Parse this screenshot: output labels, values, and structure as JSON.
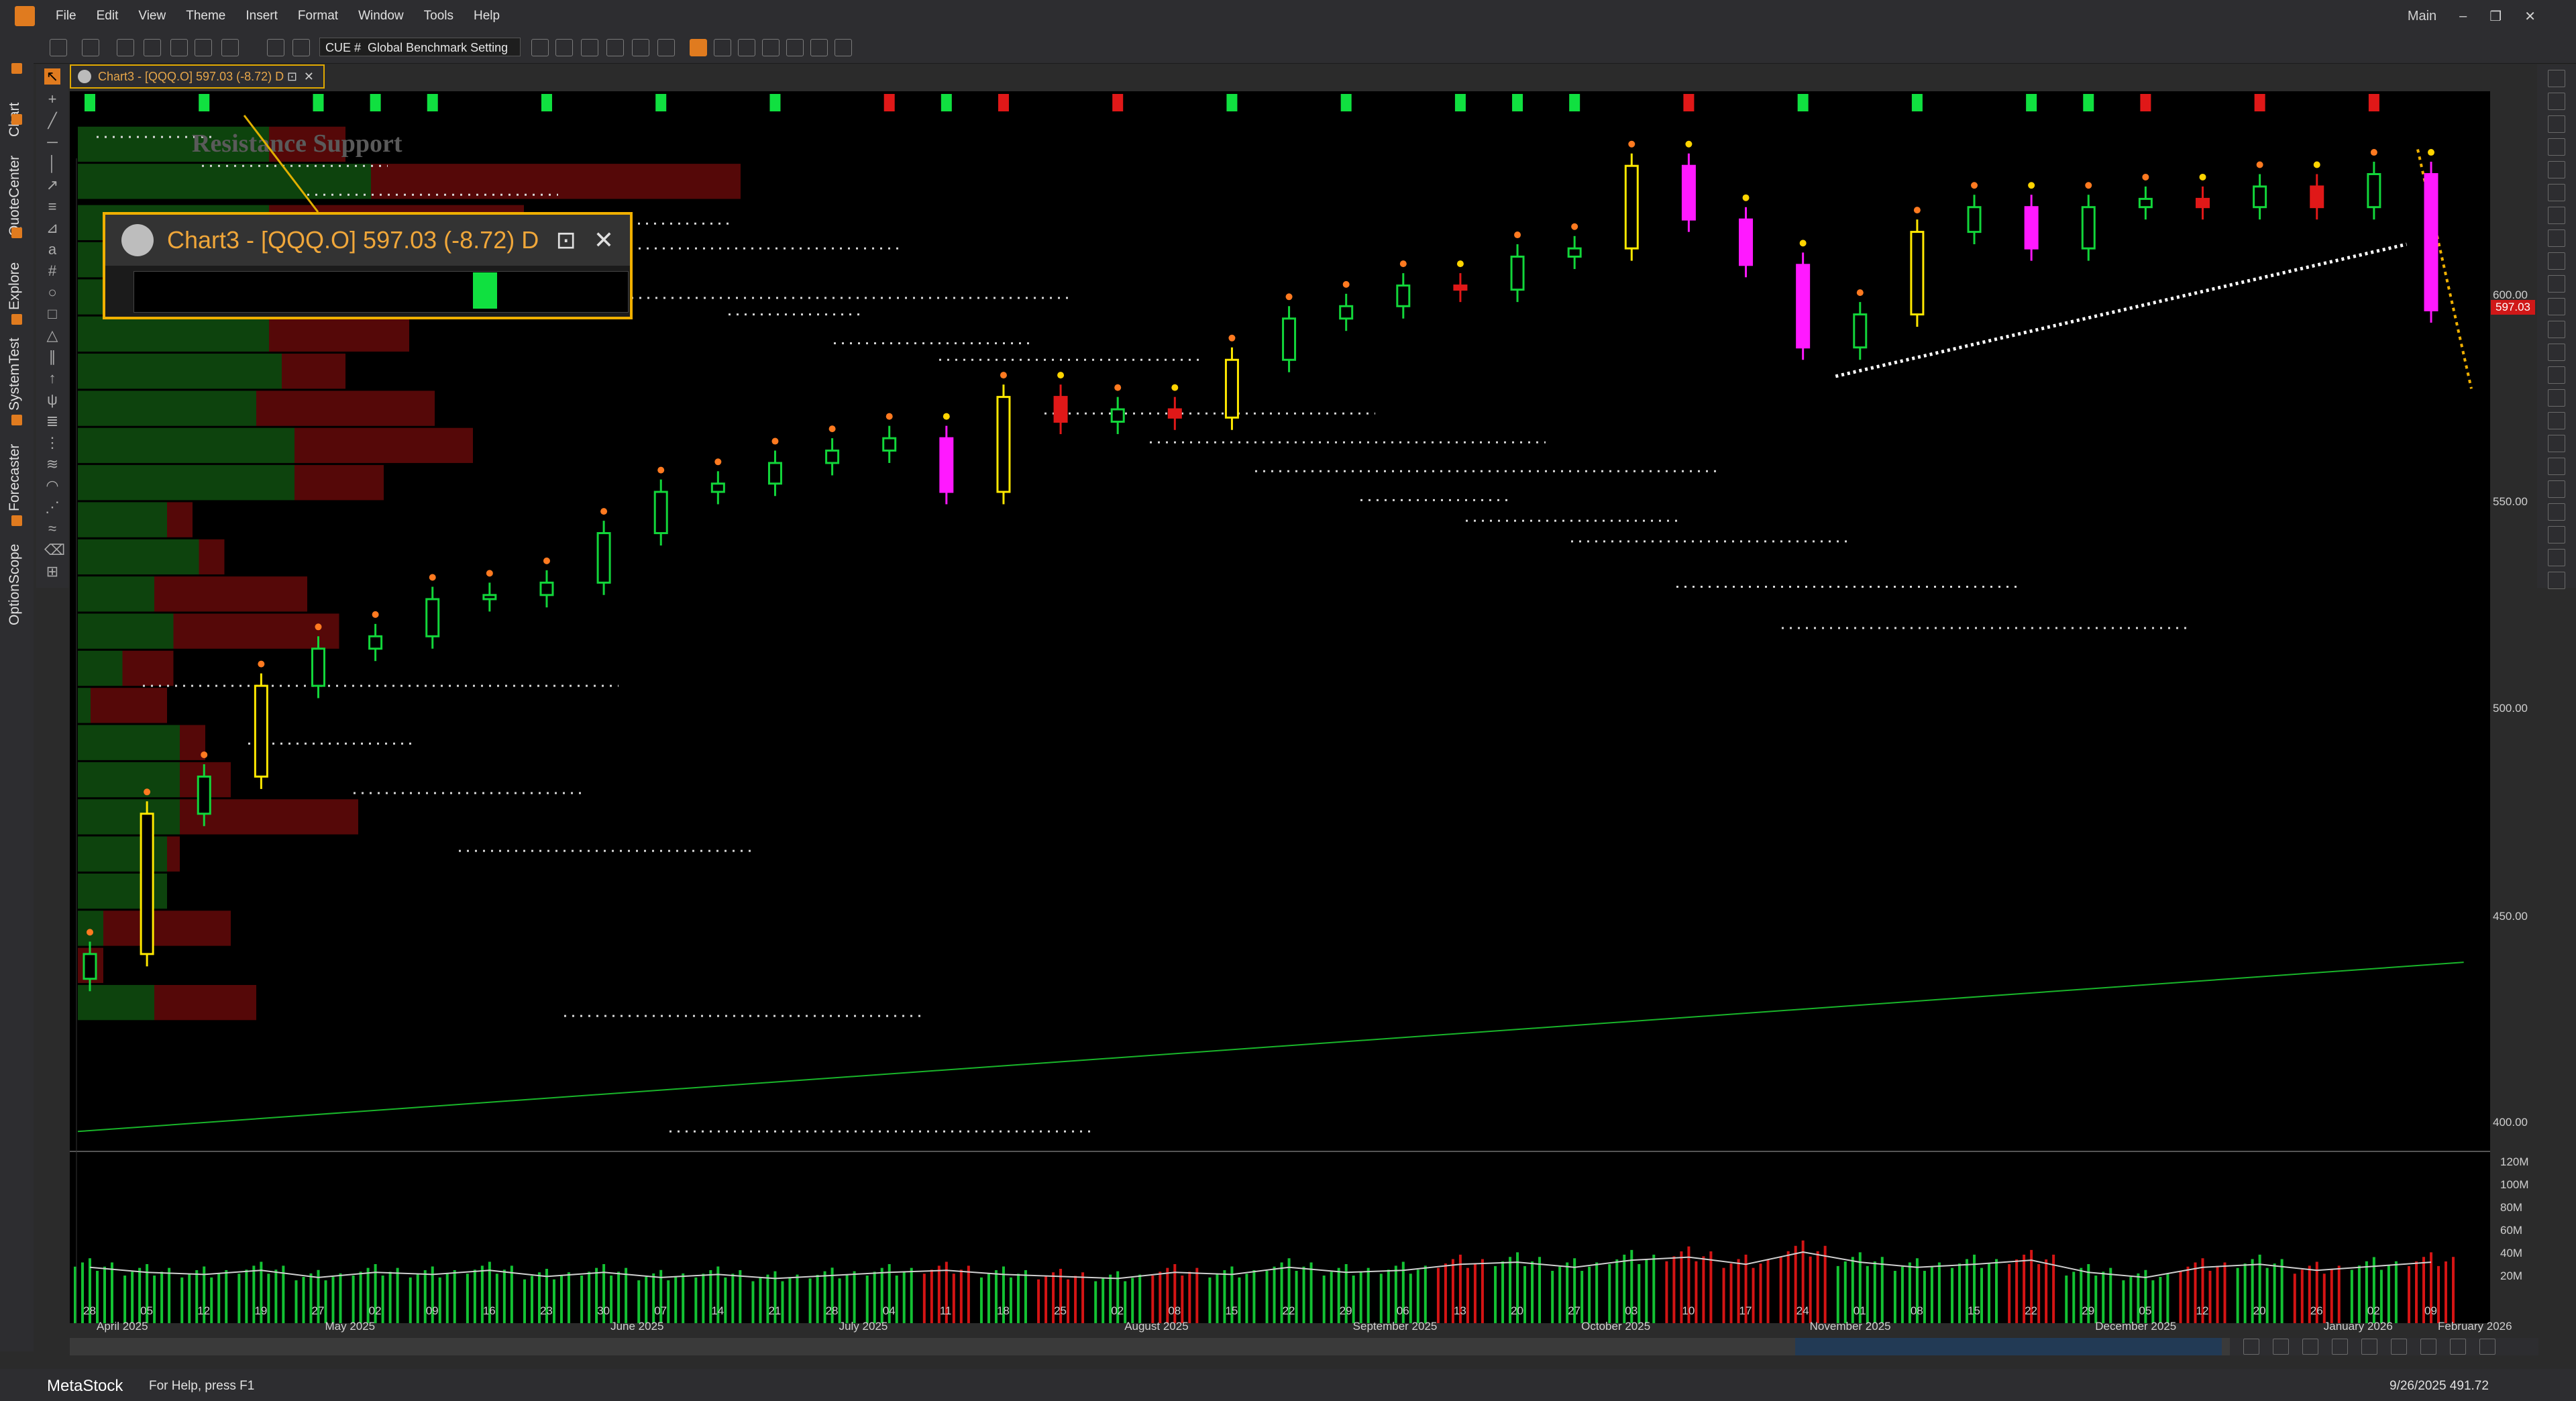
{
  "menu": [
    "File",
    "Edit",
    "View",
    "Theme",
    "Insert",
    "Format",
    "Window",
    "Tools",
    "Help"
  ],
  "window_controls": {
    "layout": "Main",
    "minimize": "–",
    "restore": "❐",
    "close": "✕"
  },
  "toolbar": {
    "cue_label": "CUE #",
    "benchmark_select": "Global Benchmark Setting"
  },
  "left_tabs": [
    "Chart",
    "QuoteCenter",
    "Explore",
    "SystemTest",
    "Forecaster",
    "OptionScope"
  ],
  "chart_tab": {
    "title": "Chart3 - [QQQ.O] 597.03 (-8.72) D",
    "pin": "⊡",
    "close": "✕"
  },
  "popup": {
    "title": "Chart3 - [QQQ.O] 597.03 (-8.72) D",
    "pin": "⊡",
    "close": "✕"
  },
  "annotation": "Resistance Support",
  "price_axis": {
    "labels": [
      "600.00",
      "550.00",
      "500.00",
      "450.00",
      "400.00"
    ],
    "last_price": "597.03"
  },
  "volume_axis": {
    "labels": [
      "120M",
      "100M",
      "80M",
      "60M",
      "40M",
      "20M"
    ]
  },
  "date_axis": {
    "days": [
      "28",
      "05",
      "12",
      "19",
      "27",
      "02",
      "09",
      "16",
      "23",
      "30",
      "07",
      "14",
      "21",
      "28",
      "04",
      "11",
      "18",
      "25",
      "02",
      "08",
      "15",
      "22",
      "29",
      "06",
      "13",
      "20",
      "27",
      "03",
      "10",
      "17",
      "24",
      "01",
      "08",
      "15",
      "22",
      "29",
      "05",
      "12",
      "20",
      "26",
      "02",
      "09"
    ],
    "months": [
      "April 2025",
      "May 2025",
      "June 2025",
      "July 2025",
      "August 2025",
      "September 2025",
      "October 2025",
      "November 2025",
      "December 2025",
      "January 2026",
      "February 2026"
    ]
  },
  "status": {
    "brand": "MetaStock",
    "help": "For Help, press F1",
    "cursor_readout": "9/26/2025 491.72"
  },
  "chart_data": {
    "type": "candlestick",
    "symbol": "QQQ.O",
    "last": 597.03,
    "change": -8.72,
    "periodicity": "D",
    "ylim": [
      395,
      645
    ],
    "x": [
      "2025-04-21",
      "2025-04-28",
      "2025-05-05",
      "2025-05-12",
      "2025-05-19",
      "2025-05-27",
      "2025-06-02",
      "2025-06-09",
      "2025-06-16",
      "2025-06-23",
      "2025-06-30",
      "2025-07-07",
      "2025-07-14",
      "2025-07-21",
      "2025-07-28",
      "2025-08-04",
      "2025-08-11",
      "2025-08-18",
      "2025-08-25",
      "2025-09-02",
      "2025-09-08",
      "2025-09-15",
      "2025-09-22",
      "2025-09-29",
      "2025-10-06",
      "2025-10-13",
      "2025-10-20",
      "2025-10-27",
      "2025-11-03",
      "2025-11-10",
      "2025-11-17",
      "2025-11-24",
      "2025-12-01",
      "2025-12-08",
      "2025-12-15",
      "2025-12-22",
      "2025-12-29",
      "2026-01-05",
      "2026-01-12",
      "2026-01-20",
      "2026-01-26",
      "2026-02-02"
    ],
    "close": [
      441,
      475,
      484,
      506,
      515,
      518,
      527,
      528,
      531,
      543,
      553,
      555,
      560,
      563,
      566,
      553,
      576,
      570,
      573,
      571,
      585,
      595,
      598,
      603,
      602,
      610,
      612,
      632,
      619,
      608,
      588,
      596,
      616,
      622,
      612,
      622,
      624,
      622,
      627,
      622,
      630,
      597
    ],
    "volume_m": [
      55,
      50,
      48,
      52,
      45,
      50,
      48,
      52,
      46,
      50,
      45,
      48,
      44,
      47,
      50,
      52,
      48,
      46,
      44,
      50,
      48,
      55,
      50,
      52,
      58,
      60,
      55,
      62,
      65,
      58,
      70,
      60,
      55,
      58,
      62,
      50,
      45,
      55,
      58,
      52,
      56,
      60
    ],
    "volume_ylim": [
      0,
      130
    ],
    "volume_profile": [
      {
        "price": 637,
        "up": 150,
        "down": 60
      },
      {
        "price": 628,
        "up": 230,
        "down": 290
      },
      {
        "price": 618,
        "up": 150,
        "down": 200
      },
      {
        "price": 609,
        "up": 110,
        "down": 320
      },
      {
        "price": 600,
        "up": 150,
        "down": 210
      },
      {
        "price": 591,
        "up": 150,
        "down": 110
      },
      {
        "price": 582,
        "up": 160,
        "down": 50
      },
      {
        "price": 573,
        "up": 140,
        "down": 140
      },
      {
        "price": 564,
        "up": 170,
        "down": 140
      },
      {
        "price": 555,
        "up": 170,
        "down": 70
      },
      {
        "price": 546,
        "up": 70,
        "down": 20
      },
      {
        "price": 537,
        "up": 95,
        "down": 20
      },
      {
        "price": 528,
        "up": 60,
        "down": 120
      },
      {
        "price": 519,
        "up": 75,
        "down": 130
      },
      {
        "price": 510,
        "up": 35,
        "down": 40
      },
      {
        "price": 501,
        "up": 10,
        "down": 60
      },
      {
        "price": 492,
        "up": 80,
        "down": 20
      },
      {
        "price": 483,
        "up": 80,
        "down": 40
      },
      {
        "price": 474,
        "up": 80,
        "down": 140
      },
      {
        "price": 465,
        "up": 70,
        "down": 10
      },
      {
        "price": 456,
        "up": 70,
        "down": 0
      },
      {
        "price": 447,
        "up": 20,
        "down": 100
      },
      {
        "price": 438,
        "up": 0,
        "down": 20
      },
      {
        "price": 429,
        "up": 60,
        "down": 80
      }
    ],
    "support_resistance": [
      639,
      632,
      625,
      618,
      612,
      600,
      596,
      589,
      585,
      572,
      565,
      558,
      551,
      546,
      541,
      530,
      520,
      506,
      492,
      480,
      466,
      426,
      398
    ],
    "trendline": {
      "from": [
        "2025-11-21",
        581
      ],
      "to": [
        "2026-01-30",
        613
      ]
    },
    "long_trend": {
      "from": [
        "2025-04-07",
        398
      ],
      "to": [
        "2026-02-06",
        439
      ]
    }
  }
}
